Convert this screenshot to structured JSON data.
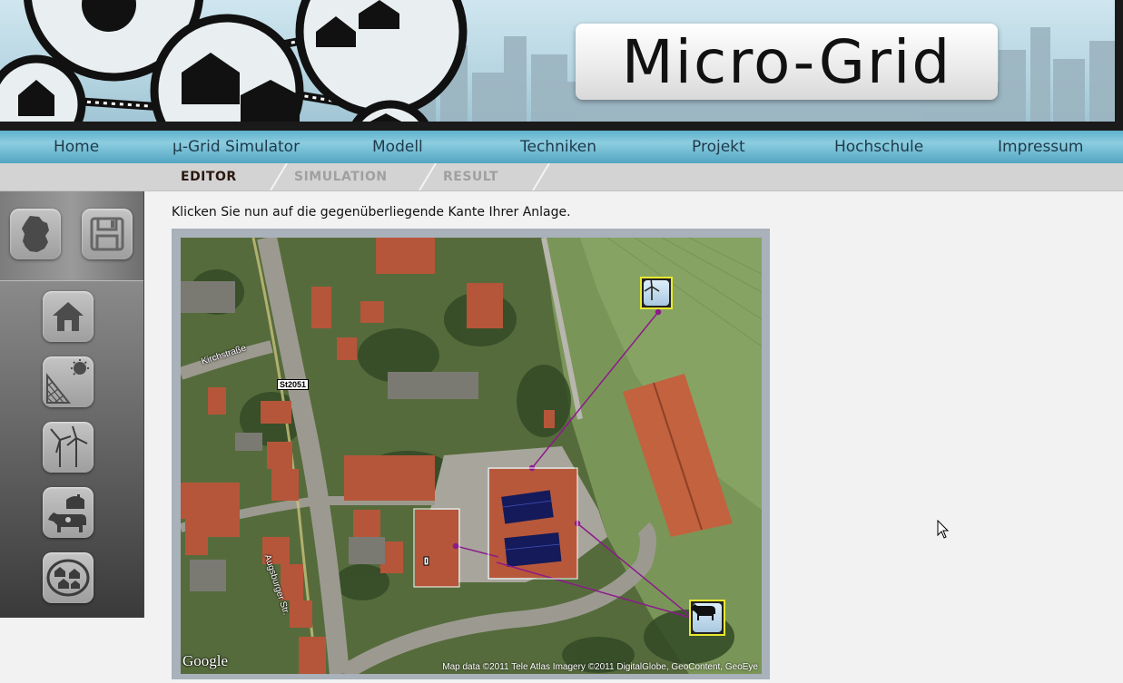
{
  "header": {
    "logo_text": "Micro-Grid"
  },
  "nav": {
    "items": [
      "Home",
      "μ-Grid Simulator",
      "Modell",
      "Techniken",
      "Projekt",
      "Hochschule",
      "Impressum"
    ]
  },
  "tabs": {
    "items": [
      "EDITOR",
      "SIMULATION",
      "RESULT"
    ],
    "active": "EDITOR"
  },
  "sidebar": {
    "top_tools": [
      "germany-map-icon",
      "save-icon"
    ],
    "tools": [
      "house-icon",
      "solar-panel-icon",
      "wind-turbine-icon",
      "biogas-cow-icon",
      "microgrid-group-icon"
    ]
  },
  "main": {
    "instruction": "Klicken Sie nun auf die gegenüberliegende Kante Ihrer Anlage."
  },
  "map": {
    "street_1": "Kirchstraße",
    "street_2": "Augsburger Str.",
    "road_badge": "St2051",
    "logo": "Google",
    "attribution": "Map data ©2011 Tele Atlas  Imagery ©2011 DigitalGlobe, GeoContent, GeoEye",
    "nodes": [
      "wind-turbine-node",
      "biogas-cow-node"
    ],
    "edge_color": "#8b1a8b"
  },
  "colors": {
    "nav_bg": "#6fbfd8",
    "tab_active": "#2a1810",
    "tab_inactive": "#a0a0a0",
    "node_border": "#e8e830"
  }
}
